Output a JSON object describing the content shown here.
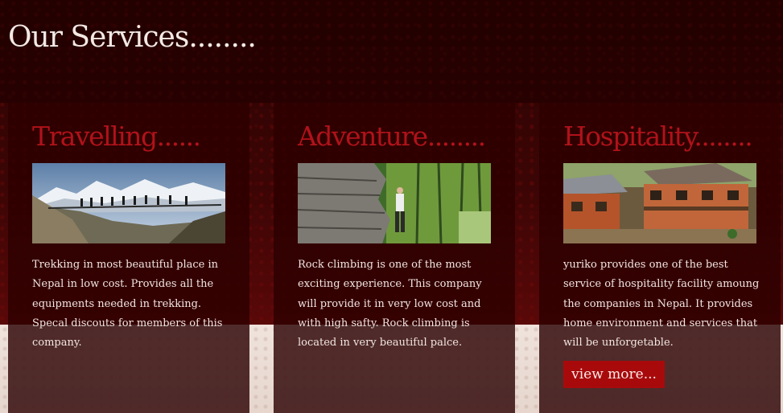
{
  "page": {
    "title": "Our Services........"
  },
  "services": [
    {
      "title": "Travelling......",
      "image": "trekkers-on-bridge-mountains",
      "text": "Trekking in most beautiful place in Nepal in low cost. Provides all the equipments needed in trekking. Specal discouts for members of this company."
    },
    {
      "title": "Adventure........",
      "image": "rock-climber-forest",
      "text": "Rock climbing is one of the most exciting experience. This company will provide it in very low cost and with high safty. Rock climbing is located in very beautiful palce."
    },
    {
      "title": "Hospitality........",
      "image": "traditional-nepali-house",
      "text": "yuriko provides one of the best service of hospitality facility amoung the companies in Nepal. It provides home environment and services that will be unforgetable.",
      "button_label": "view more..."
    }
  ],
  "colors": {
    "title_red": "#b0121a",
    "button_red": "#a80a0c",
    "background": "#3a0606"
  }
}
